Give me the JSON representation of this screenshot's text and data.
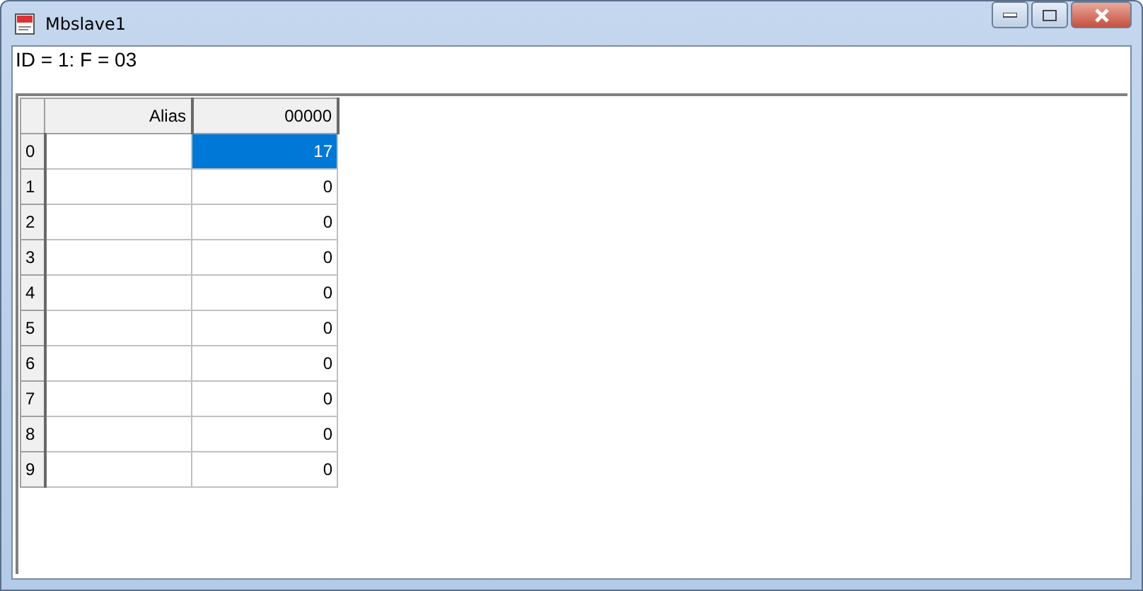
{
  "window": {
    "title": "Mbslave1"
  },
  "header": "ID = 1: F = 03",
  "table": {
    "columns": [
      "Alias",
      "00000"
    ],
    "rows": [
      {
        "index": "0",
        "value": "17",
        "selected": true
      },
      {
        "index": "1",
        "value": "0",
        "selected": false
      },
      {
        "index": "2",
        "value": "0",
        "selected": false
      },
      {
        "index": "3",
        "value": "0",
        "selected": false
      },
      {
        "index": "4",
        "value": "0",
        "selected": false
      },
      {
        "index": "5",
        "value": "0",
        "selected": false
      },
      {
        "index": "6",
        "value": "0",
        "selected": false
      },
      {
        "index": "7",
        "value": "0",
        "selected": false
      },
      {
        "index": "8",
        "value": "0",
        "selected": false
      },
      {
        "index": "9",
        "value": "0",
        "selected": false
      }
    ]
  }
}
